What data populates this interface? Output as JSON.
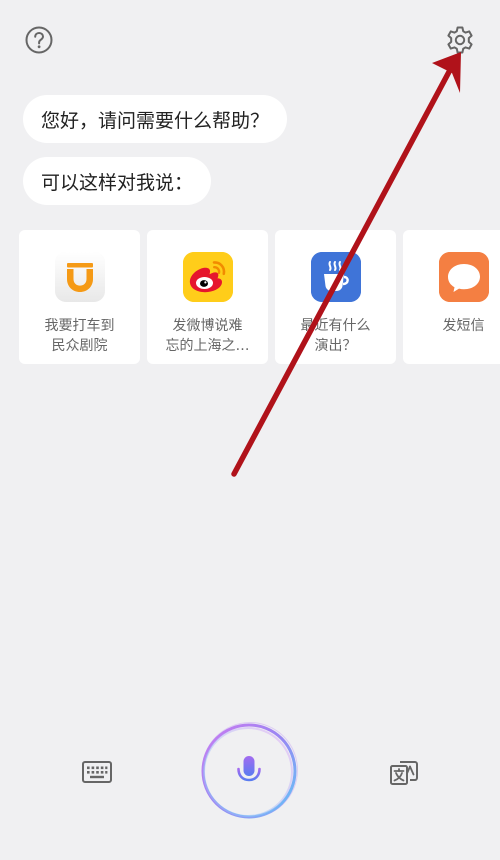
{
  "header": {
    "help_icon": "help-circle-icon",
    "settings_icon": "gear-icon"
  },
  "chat": {
    "greeting": "您好，请问需要什么帮助？",
    "prompt": "可以这样对我说："
  },
  "suggestions": [
    {
      "label": "我要打车到\n民众剧院",
      "icon": "didi-icon",
      "color": "#f39c12"
    },
    {
      "label": "发微博说难\n忘的上海之…",
      "icon": "weibo-icon",
      "color": "#e6162d"
    },
    {
      "label": "最近有什么\n演出？",
      "icon": "coffee-cup-icon",
      "color": "#3f74d8"
    },
    {
      "label": "发短信",
      "icon": "message-bubble-icon",
      "color": "#f47f42"
    }
  ],
  "bottom": {
    "keyboard_icon": "keyboard-icon",
    "mic_icon": "microphone-icon",
    "translate_icon": "translate-icon"
  },
  "annotation": {
    "arrow_color": "#b0121a"
  }
}
